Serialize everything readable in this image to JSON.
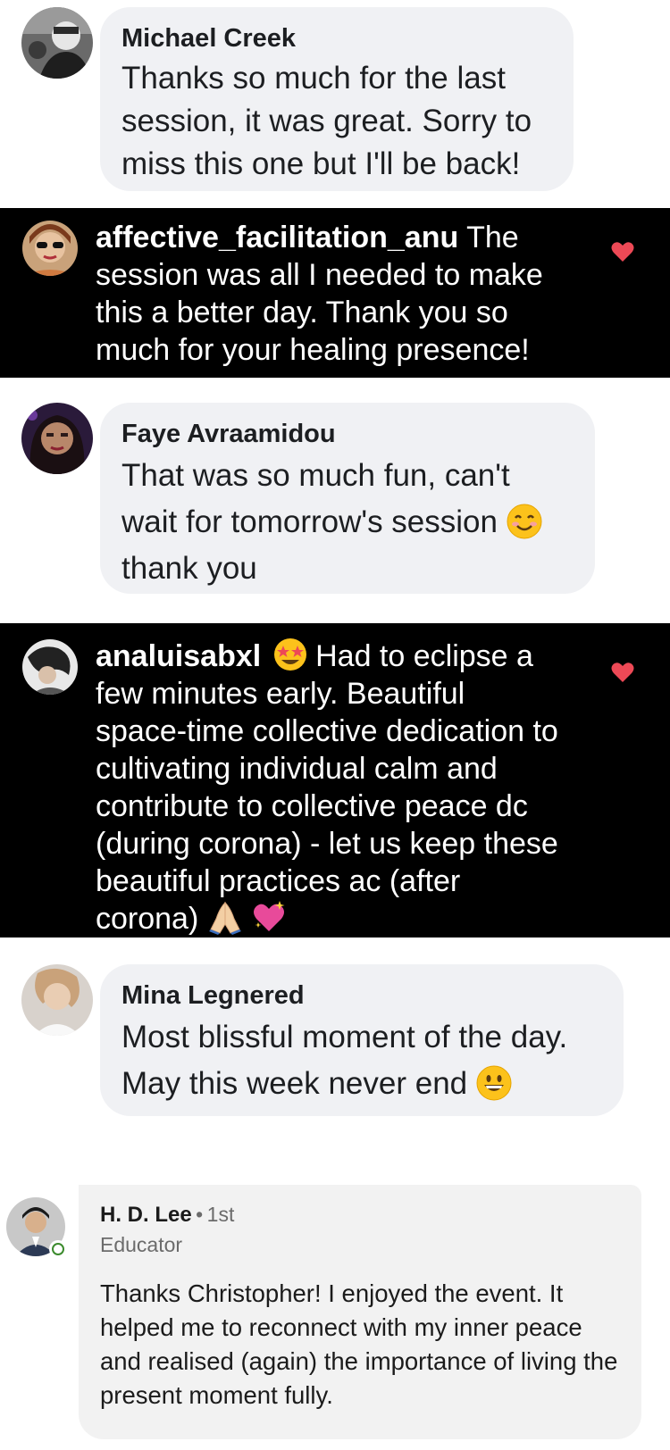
{
  "comments": [
    {
      "platform": "facebook",
      "name": "Michael Creek",
      "text": "Thanks so much for the last session, it was great. Sorry to miss this one but I'll be back!"
    },
    {
      "platform": "instagram",
      "username": "affective_facilitation_anu",
      "text": "The session was all I needed to make this a better day. Thank you so much for your healing presence!",
      "liked": true
    },
    {
      "platform": "facebook",
      "name": "Faye Avraamidou",
      "text_line1": "That was so much fun, can't",
      "text_line2": "wait for tomorrow's session",
      "text_line3": "thank you",
      "emoji": "smiling-face-emoji"
    },
    {
      "platform": "instagram",
      "username": "analuisabxl",
      "text_first": "Had to eclipse a few minutes early. Beautiful space-time collective dedication to cultivating individual calm and contribute to collective peace dc (during corona) - let us keep these beautiful practices ac (after corona)",
      "emojis": [
        "star-struck-emoji",
        "folded-hands-emoji",
        "sparkling-heart-emoji"
      ],
      "liked": true
    },
    {
      "platform": "facebook",
      "name": "Mina Legnered",
      "text_line1": "Most blissful moment of the day.",
      "text_line2": "May this week never end",
      "emoji": "grinning-face-emoji"
    },
    {
      "platform": "linkedin",
      "name": "H. D. Lee",
      "separator": "•",
      "degree": "1st",
      "headline": "Educator",
      "text": "Thanks Christopher! I enjoyed the event. It helped me to reconnect with my inner peace and realised (again) the importance of living the present moment fully."
    }
  ],
  "colors": {
    "fb_bubble": "#f0f1f4",
    "ig_background": "#000000",
    "heart": "#ed4956",
    "li_card": "#f2f2f2",
    "online": "#3b8a2c"
  }
}
